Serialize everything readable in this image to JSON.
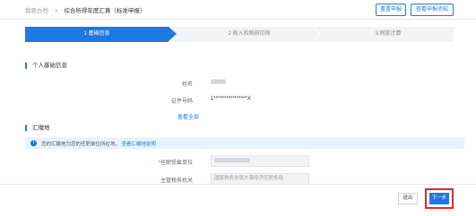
{
  "breadcrumb": {
    "home": "我要办税",
    "separator": ">",
    "current": "综合所得年度汇算（标准申报）"
  },
  "top_buttons": {
    "reset": "重置申报",
    "instructions": "查看申报须知"
  },
  "steps": [
    {
      "label": "1 基础信息",
      "active": true
    },
    {
      "label": "2 收入和税前扣除",
      "active": false
    },
    {
      "label": "3 税款计算",
      "active": false
    }
  ],
  "personal": {
    "section_title": "个人基础信息",
    "name_label": "姓名",
    "id_label": "证件号码",
    "id_value": "1****************X",
    "view_all": "查看全部"
  },
  "settlement": {
    "section_title": "汇缴地",
    "notice_text": "您的汇缴地为您的任职单位所在地。",
    "notice_link": "查看汇缴地说明",
    "employer_label": "任职受雇单位",
    "tax_authority_label": "主管税务机关",
    "tax_authority_value": "国家税务总局大港经济区税务局"
  },
  "footer": {
    "cancel": "退出",
    "next": "下一步"
  },
  "colors": {
    "accent": "#1d79e0",
    "highlight": "#e8262a",
    "info_bg": "#e8f3fd"
  }
}
